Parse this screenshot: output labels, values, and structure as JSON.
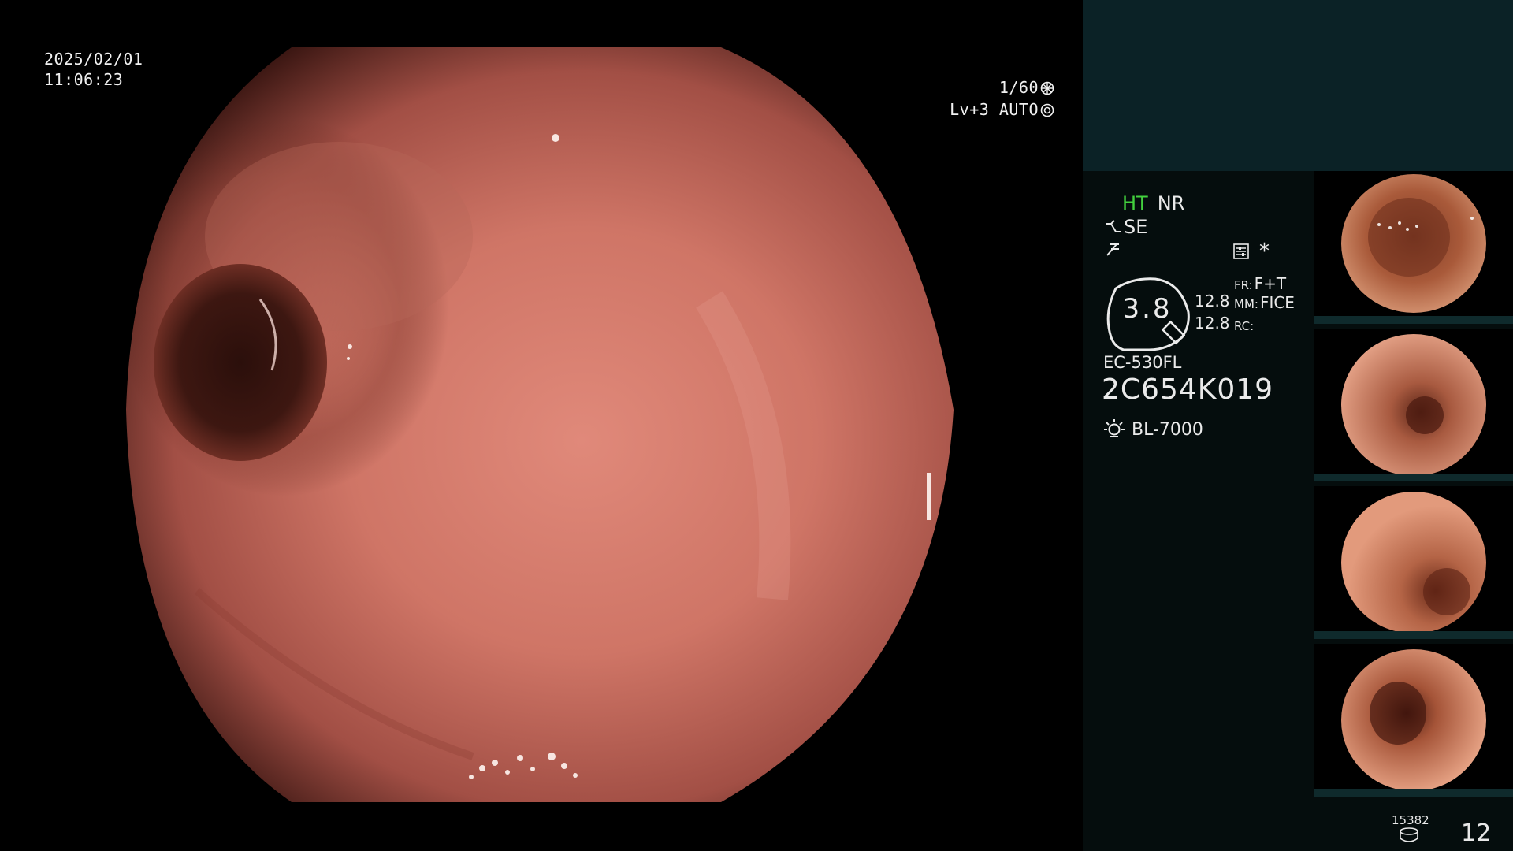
{
  "overlay": {
    "date": "2025/02/01",
    "time": "11:06:23",
    "shutter": "1/60",
    "level": "Lv+3 AUTO"
  },
  "panel": {
    "ht": "HT",
    "nr": "NR",
    "se": "SE",
    "gauge_value": "3.8",
    "gauge_val_a": "12.8",
    "gauge_val_b": "12.8",
    "fr_key": "FR:",
    "fr_value": "F+T",
    "mm_key": "MM:",
    "mm_value": "FICE",
    "rc_key": "RC:",
    "rc_value": "",
    "scope_model": "EC-530FL",
    "serial": "2C654K019",
    "light_source": "BL-7000",
    "storage_count": "15382",
    "image_count": "12"
  },
  "colors": {
    "ht_green": "#43d13e",
    "panel_header": "#0b2226",
    "panel_bg": "#050d0d"
  },
  "icons": [
    "shutter-icon",
    "iris-icon",
    "se-icon",
    "f-icon",
    "control-icon",
    "lamp-icon",
    "storage-icon"
  ]
}
